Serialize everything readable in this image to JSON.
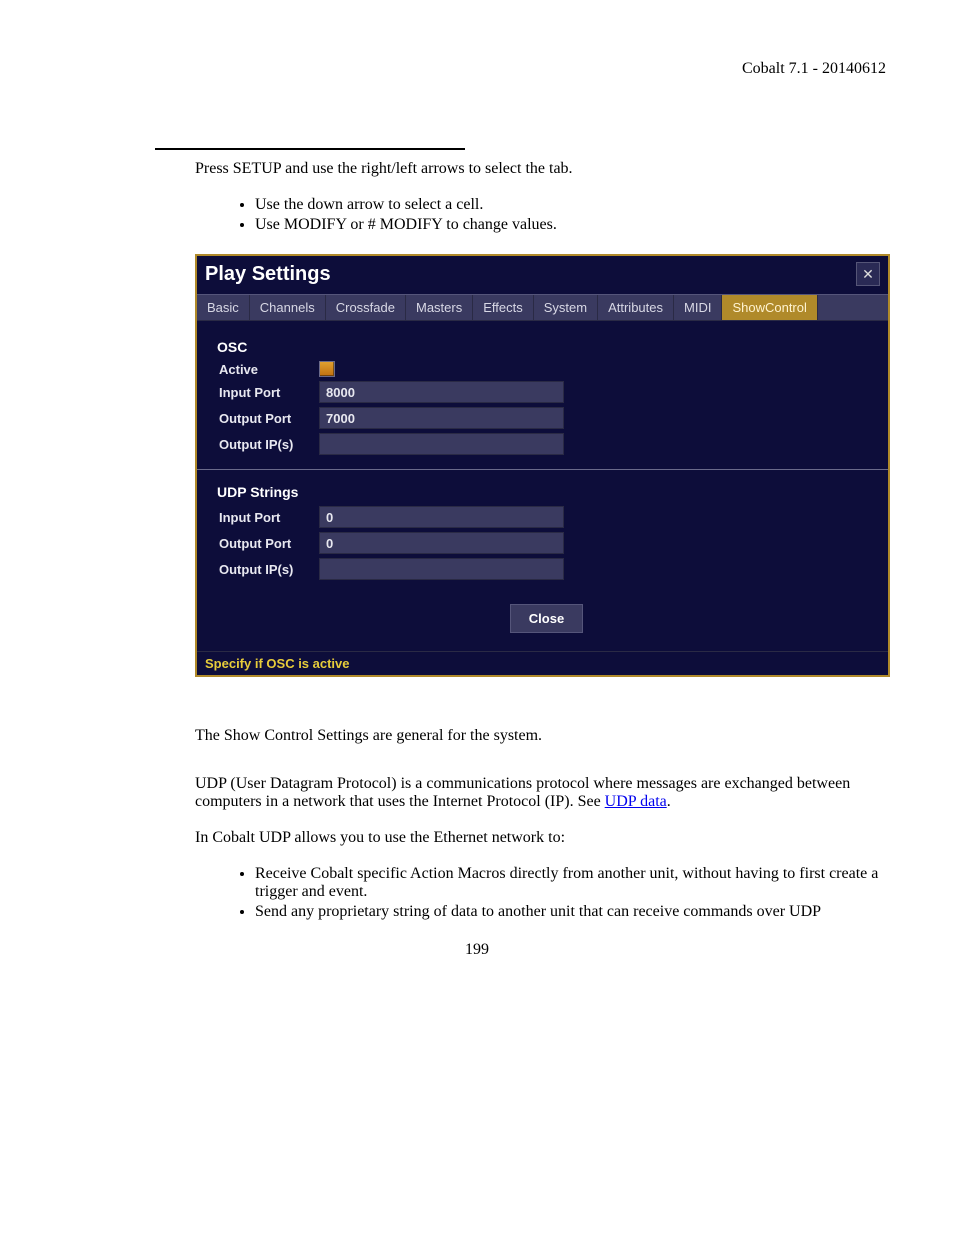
{
  "header": {
    "title": "Cobalt 7.1 - 20140612"
  },
  "intro": {
    "line1_a": "Press SETUP and use the right/left arrows to select the ",
    "line1_b": " tab.",
    "bullets": [
      "Use the down arrow to select a cell.",
      "Use MODIFY or # MODIFY to change values."
    ]
  },
  "panel": {
    "title": "Play Settings",
    "tabs": [
      "Basic",
      "Channels",
      "Crossfade",
      "Masters",
      "Effects",
      "System",
      "Attributes",
      "MIDI",
      "ShowControl"
    ],
    "active_tab_index": 8,
    "osc": {
      "heading": "OSC",
      "active_label": "Active",
      "input_port_label": "Input Port",
      "input_port_value": "8000",
      "output_port_label": "Output Port",
      "output_port_value": "7000",
      "output_ips_label": "Output IP(s)",
      "output_ips_value": ""
    },
    "udp": {
      "heading": "UDP Strings",
      "input_port_label": "Input Port",
      "input_port_value": "0",
      "output_port_label": "Output Port",
      "output_port_value": "0",
      "output_ips_label": "Output IP(s)",
      "output_ips_value": ""
    },
    "close_label": "Close",
    "status": "Specify if OSC is active"
  },
  "after": {
    "p1": "The Show Control Settings are general for the system.",
    "p2_a": "UDP (User Datagram Protocol) is a communications protocol where messages are exchanged between computers in a network that uses the Internet Protocol (IP). See ",
    "p2_link": "UDP data",
    "p2_b": ".",
    "p3": "In Cobalt UDP allows you to use the Ethernet network to:",
    "bullets": [
      "Receive Cobalt specific Action Macros directly from another unit, without having to first create a trigger and event.",
      "Send any proprietary string of data to another unit that can receive commands over UDP"
    ]
  },
  "page_number": "199"
}
